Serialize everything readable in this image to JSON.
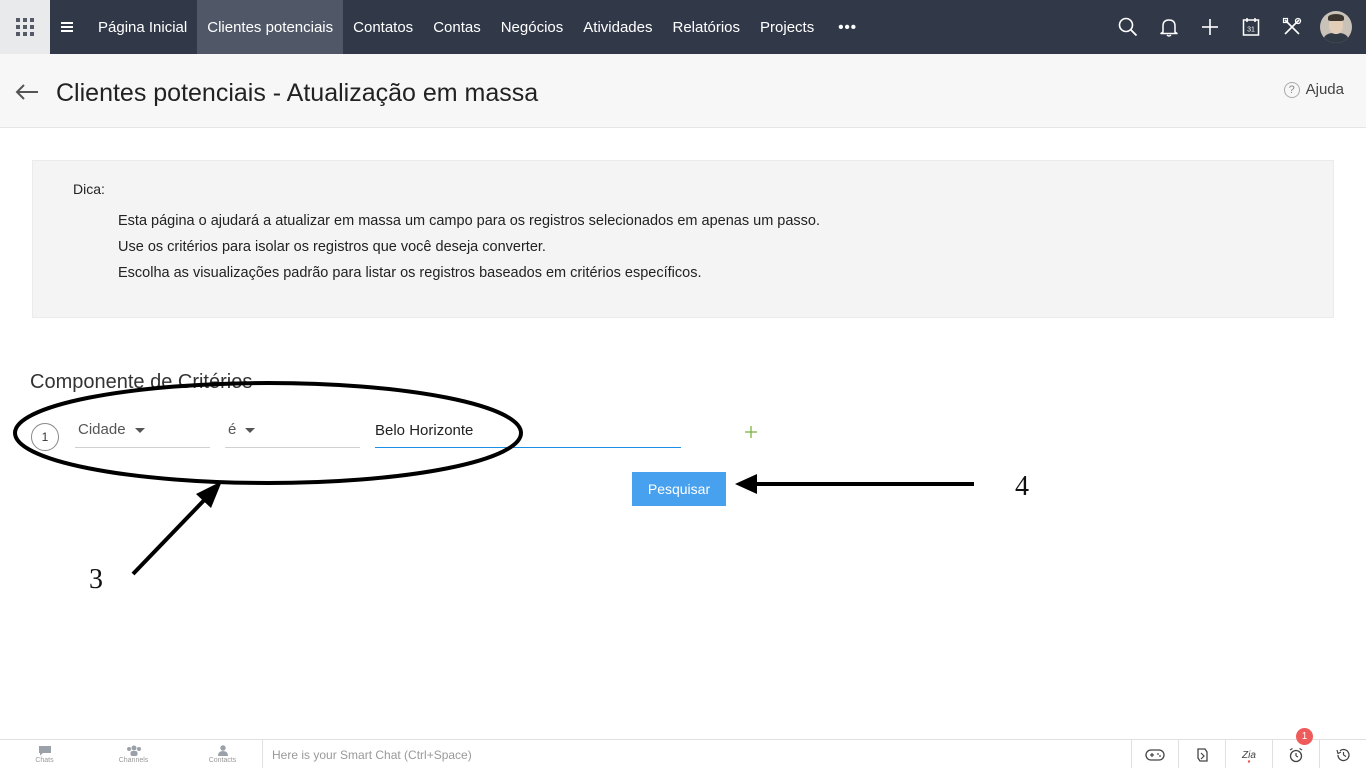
{
  "topnav": {
    "tabs": [
      {
        "label": "Página Inicial"
      },
      {
        "label": "Clientes potenciais"
      },
      {
        "label": "Contatos"
      },
      {
        "label": "Contas"
      },
      {
        "label": "Negócios"
      },
      {
        "label": "Atividades"
      },
      {
        "label": "Relatórios"
      },
      {
        "label": "Projects"
      }
    ],
    "active_tab": "Clientes potenciais",
    "more_label": "•••",
    "right_icons": [
      "search-icon",
      "bell-icon",
      "plus-icon",
      "calendar-icon",
      "tools-icon",
      "user-avatar"
    ],
    "calendar_day": "31",
    "colors": {
      "bar": "#313949",
      "active_tab": "#505867",
      "apps_button": "#e9eaec"
    }
  },
  "header": {
    "title": "Clientes potenciais - Atualização em massa",
    "help_label": "Ajuda",
    "help_glyph": "?"
  },
  "tip": {
    "label": "Dica:",
    "lines": [
      "Esta página o ajudará a atualizar em massa um campo para os registros selecionados em apenas um passo.",
      "Use os critérios para isolar os registros que você deseja converter.",
      "Escolha as visualizações padrão para listar os registros baseados em critérios específicos."
    ]
  },
  "criteria": {
    "heading": "Componente de Critérios",
    "row_number": "1",
    "field": "Cidade",
    "operator": "é",
    "value": "Belo Horizonte",
    "search_label": "Pesquisar",
    "accent_color": "#48a1ee"
  },
  "annotations": {
    "label_3": "3",
    "label_4": "4"
  },
  "bottom_bar": {
    "items": [
      {
        "label": "Chats",
        "icon": "chat-icon"
      },
      {
        "label": "Channels",
        "icon": "channels-icon"
      },
      {
        "label": "Contacts",
        "icon": "contacts-icon"
      }
    ],
    "smart_chat_placeholder": "Here is your Smart Chat (Ctrl+Space)",
    "right_icons": [
      "gamepad-icon",
      "cycle-icon",
      "zia-icon",
      "alarm-icon",
      "history-icon"
    ],
    "notification_count": "1"
  }
}
